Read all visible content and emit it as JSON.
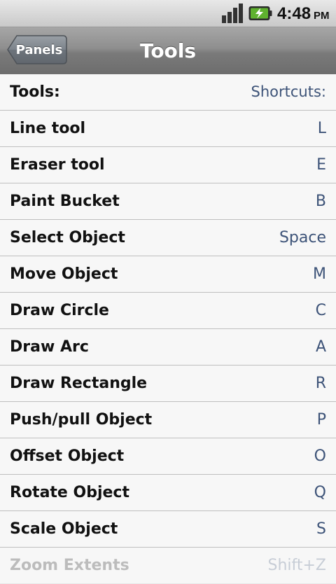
{
  "status_bar": {
    "time": "4:48",
    "ampm": "PM",
    "signal_icon": "signal-bars-icon",
    "battery_icon": "battery-charging-icon"
  },
  "title_bar": {
    "back_label": "Panels",
    "title": "Tools"
  },
  "list": {
    "header": {
      "name": "Tools:",
      "key": "Shortcuts:"
    },
    "rows": [
      {
        "name": "Line tool",
        "key": "L"
      },
      {
        "name": "Eraser tool",
        "key": "E"
      },
      {
        "name": "Paint Bucket",
        "key": "B"
      },
      {
        "name": "Select Object",
        "key": "Space"
      },
      {
        "name": "Move Object",
        "key": "M"
      },
      {
        "name": "Draw Circle",
        "key": "C"
      },
      {
        "name": "Draw Arc",
        "key": "A"
      },
      {
        "name": "Draw Rectangle",
        "key": "R"
      },
      {
        "name": "Push/pull Object",
        "key": "P"
      },
      {
        "name": "Offset Object",
        "key": "O"
      },
      {
        "name": "Rotate Object",
        "key": "Q"
      },
      {
        "name": "Scale Object",
        "key": "S"
      },
      {
        "name": "Zoom Extents",
        "key": "Shift+Z"
      }
    ]
  },
  "colors": {
    "shortcut_text": "#3d5378",
    "row_divider": "#bfbfbf",
    "title_bar": "#8e8e8e"
  }
}
